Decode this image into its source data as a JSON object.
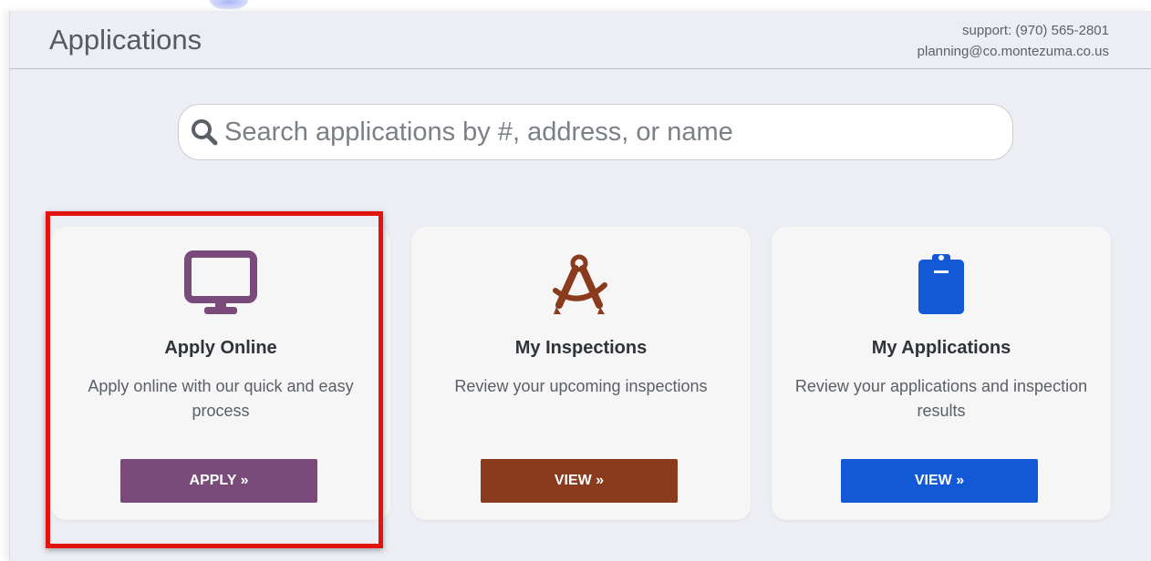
{
  "header": {
    "title": "Applications",
    "support_phone": "support: (970) 565-2801",
    "support_email": "planning@co.montezuma.co.us"
  },
  "search": {
    "placeholder": "Search applications by #, address, or name",
    "icon": "search-icon"
  },
  "cards": [
    {
      "icon": "monitor-icon",
      "title": "Apply Online",
      "description": "Apply online with our quick and easy process",
      "button_label": "APPLY »",
      "color": "#7a4a7a"
    },
    {
      "icon": "drafting-compass-icon",
      "title": "My Inspections",
      "description": "Review your upcoming inspections",
      "button_label": "VIEW »",
      "color": "#8a3b1e"
    },
    {
      "icon": "clipboard-icon",
      "title": "My Applications",
      "description": "Review your applications and inspection results",
      "button_label": "VIEW »",
      "color": "#1359d6"
    }
  ],
  "annotation": {
    "highlight_color": "#e3130f"
  }
}
